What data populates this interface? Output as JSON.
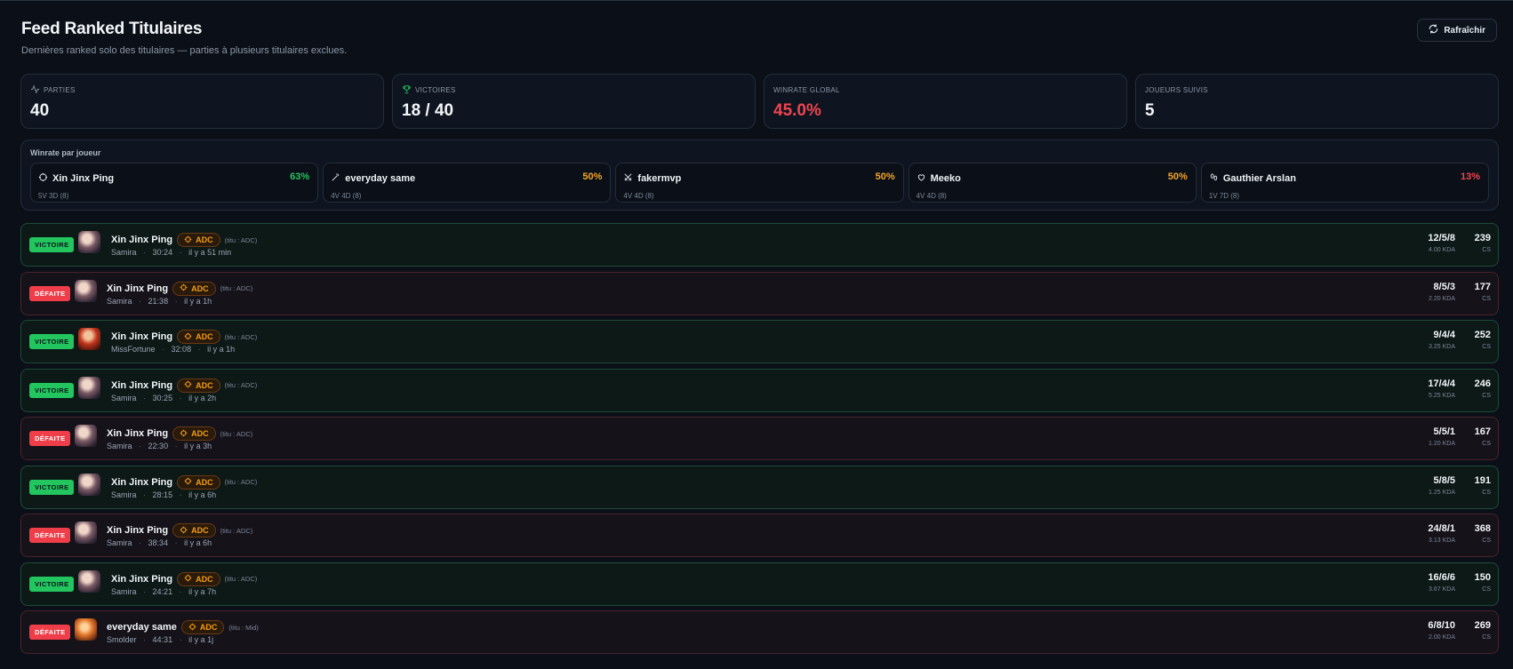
{
  "header": {
    "title": "Feed Ranked Titulaires",
    "subtitle": "Dernières ranked solo des titulaires — parties à plusieurs titulaires exclues.",
    "refresh_label": "Rafraîchir"
  },
  "stats": [
    {
      "label": "PARTIES",
      "value": "40",
      "icon": "activity-icon"
    },
    {
      "label": "VICTOIRES",
      "value": "18 / 40",
      "icon": "trophy-icon"
    },
    {
      "label": "WINRATE GLOBAL",
      "value": "45.0%"
    },
    {
      "label": "JOUEURS SUIVIS",
      "value": "5"
    }
  ],
  "winrate_panel": {
    "title": "Winrate par joueur",
    "players": [
      {
        "name": "Xin Jinx Ping",
        "pct": "63%",
        "record": "5V 3D (8)",
        "icon": "crosshair-icon",
        "color": "#22c55e"
      },
      {
        "name": "everyday same",
        "pct": "50%",
        "record": "4V 4D (8)",
        "icon": "wand-icon",
        "color": "#f5a524"
      },
      {
        "name": "fakermvp",
        "pct": "50%",
        "record": "4V 4D (8)",
        "icon": "swords-icon",
        "color": "#f5a524"
      },
      {
        "name": "Meeko",
        "pct": "50%",
        "record": "4V 4D (8)",
        "icon": "heart-icon",
        "color": "#f5a524"
      },
      {
        "name": "Gauthier Arslan",
        "pct": "13%",
        "record": "1V 7D (8)",
        "icon": "footprints-icon",
        "color": "#f0444f"
      }
    ]
  },
  "feed": {
    "cs_label": "CS",
    "matches": [
      {
        "result": "VICTOIRE",
        "win": true,
        "player": "Xin Jinx Ping",
        "role": "ADC",
        "titu": "(titu : ADC)",
        "champion": "Samira",
        "duration": "30:24",
        "ago": "il y a 51 min",
        "kda": "12/5/8",
        "kda_ratio": "4.00 KDA",
        "cs": "239"
      },
      {
        "result": "DÉFAITE",
        "win": false,
        "player": "Xin Jinx Ping",
        "role": "ADC",
        "titu": "(titu : ADC)",
        "champion": "Samira",
        "duration": "21:38",
        "ago": "il y a 1h",
        "kda": "8/5/3",
        "kda_ratio": "2.20 KDA",
        "cs": "177"
      },
      {
        "result": "VICTOIRE",
        "win": true,
        "player": "Xin Jinx Ping",
        "role": "ADC",
        "titu": "(titu : ADC)",
        "champion": "MissFortune",
        "duration": "32:08",
        "ago": "il y a 1h",
        "kda": "9/4/4",
        "kda_ratio": "3.25 KDA",
        "cs": "252"
      },
      {
        "result": "VICTOIRE",
        "win": true,
        "player": "Xin Jinx Ping",
        "role": "ADC",
        "titu": "(titu : ADC)",
        "champion": "Samira",
        "duration": "30:25",
        "ago": "il y a 2h",
        "kda": "17/4/4",
        "kda_ratio": "5.25 KDA",
        "cs": "246"
      },
      {
        "result": "DÉFAITE",
        "win": false,
        "player": "Xin Jinx Ping",
        "role": "ADC",
        "titu": "(titu : ADC)",
        "champion": "Samira",
        "duration": "22:30",
        "ago": "il y a 3h",
        "kda": "5/5/1",
        "kda_ratio": "1.20 KDA",
        "cs": "167"
      },
      {
        "result": "VICTOIRE",
        "win": true,
        "player": "Xin Jinx Ping",
        "role": "ADC",
        "titu": "(titu : ADC)",
        "champion": "Samira",
        "duration": "28:15",
        "ago": "il y a 6h",
        "kda": "5/8/5",
        "kda_ratio": "1.25 KDA",
        "cs": "191"
      },
      {
        "result": "DÉFAITE",
        "win": false,
        "player": "Xin Jinx Ping",
        "role": "ADC",
        "titu": "(titu : ADC)",
        "champion": "Samira",
        "duration": "38:34",
        "ago": "il y a 6h",
        "kda": "24/8/1",
        "kda_ratio": "3.13 KDA",
        "cs": "368"
      },
      {
        "result": "VICTOIRE",
        "win": true,
        "player": "Xin Jinx Ping",
        "role": "ADC",
        "titu": "(titu : ADC)",
        "champion": "Samira",
        "duration": "24:21",
        "ago": "il y a 7h",
        "kda": "16/6/6",
        "kda_ratio": "3.67 KDA",
        "cs": "150"
      },
      {
        "result": "DÉFAITE",
        "win": false,
        "player": "everyday same",
        "role": "ADC",
        "titu": "(titu : Mid)",
        "champion": "Smolder",
        "duration": "44:31",
        "ago": "il y a 1j",
        "kda": "6/8/10",
        "kda_ratio": "2.00 KDA",
        "cs": "269"
      }
    ]
  }
}
